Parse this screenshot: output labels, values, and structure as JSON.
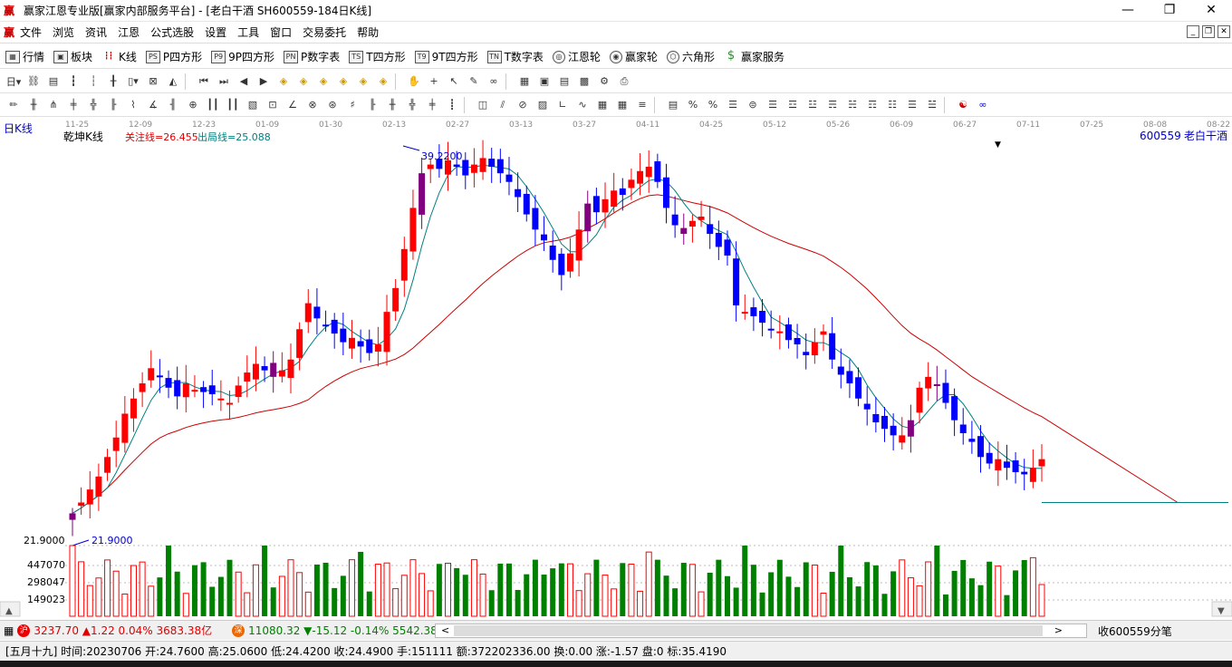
{
  "window": {
    "title": "赢家江恩专业版[赢家内部服务平台] - [老白干酒  SH600559-184日K线]",
    "logo_text": "赢"
  },
  "menu": [
    "文件",
    "浏览",
    "资讯",
    "江恩",
    "公式选股",
    "设置",
    "工具",
    "窗口",
    "交易委托",
    "帮助"
  ],
  "toolbar1": [
    {
      "label": "行情",
      "icon": "grid-icon"
    },
    {
      "label": "板块",
      "icon": "blocks-icon"
    },
    {
      "label": "K线",
      "icon": "kline-icon"
    },
    {
      "label": "P四方形",
      "icon": "ps-icon",
      "glyph": "PS"
    },
    {
      "label": "9P四方形",
      "icon": "p9-icon",
      "glyph": "P9"
    },
    {
      "label": "P数字表",
      "icon": "pn-icon",
      "glyph": "PN"
    },
    {
      "label": "T四方形",
      "icon": "ts-icon",
      "glyph": "TS"
    },
    {
      "label": "9T四方形",
      "icon": "t9-icon",
      "glyph": "T9"
    },
    {
      "label": "T数字表",
      "icon": "tn-icon",
      "glyph": "TN"
    },
    {
      "label": "江恩轮",
      "icon": "wheel-icon"
    },
    {
      "label": "赢家轮",
      "icon": "winner-wheel-icon"
    },
    {
      "label": "六角形",
      "icon": "hexagon-icon"
    },
    {
      "label": "赢家服务",
      "icon": "dollar-icon",
      "glyph": "$"
    }
  ],
  "chart": {
    "period_label": "日K线",
    "indicator_name": "乾坤K线",
    "focus_label": "关注线=26.455",
    "exit_label": "出局线=25.088",
    "stock_code": "600559",
    "stock_name": "老白干酒",
    "high_marker": "39.2200",
    "low_marker": "21.9000",
    "low_axis_label": "21.9000",
    "date_ticks": [
      "11-25",
      "12-09",
      "12-23",
      "01-09",
      "01-30",
      "02-13",
      "02-27",
      "03-13",
      "03-27",
      "04-11",
      "04-25",
      "05-12",
      "05-26",
      "06-09",
      "06-27",
      "07-11",
      "07-25",
      "08-08",
      "08-22"
    ],
    "volume_ticks": [
      "447070",
      "298047",
      "149023"
    ],
    "colors": {
      "up": "#ff0000",
      "down": "#0000ff",
      "transition": "#800080",
      "ma_short": "#008080",
      "ma_long": "#cc0000",
      "vol_up": "#ff0000",
      "vol_down": "#008000"
    }
  },
  "chart_data": {
    "type": "candlestick",
    "price_range": [
      21.9,
      39.22
    ],
    "closes": [
      22.3,
      22.8,
      23.4,
      24.0,
      24.9,
      25.8,
      26.9,
      27.6,
      28.3,
      29.0,
      28.6,
      28.1,
      27.7,
      28.3,
      28.0,
      27.9,
      27.8,
      27.6,
      27.4,
      28.2,
      28.8,
      29.2,
      28.9,
      28.6,
      28.9,
      29.4,
      30.8,
      32.0,
      31.3,
      31.0,
      30.6,
      30.2,
      30.4,
      30.0,
      29.7,
      30.1,
      31.6,
      32.7,
      34.5,
      36.4,
      38.0,
      38.4,
      38.2,
      38.6,
      38.3,
      37.9,
      38.4,
      38.7,
      38.3,
      38.0,
      37.6,
      36.9,
      36.1,
      35.4,
      34.9,
      34.0,
      33.3,
      34.3,
      35.4,
      36.6,
      36.2,
      36.8,
      37.2,
      37.0,
      37.7,
      38.1,
      38.3,
      37.6,
      36.4,
      35.6,
      35.2,
      35.8,
      36.0,
      35.2,
      34.6,
      34.2,
      31.9,
      31.6,
      31.4,
      31.1,
      30.8,
      30.7,
      30.3,
      30.1,
      29.6,
      30.2,
      30.7,
      29.4,
      28.7,
      28.3,
      27.6,
      27.1,
      26.5,
      26.2,
      25.9,
      25.9,
      26.6,
      28.1,
      28.6,
      28.2,
      27.4,
      26.6,
      26.0,
      25.6,
      24.9,
      24.6,
      24.8,
      24.4,
      24.2,
      24.1,
      24.4,
      24.8
    ],
    "ma_short_end": 22.8,
    "ma_long_end": 22.8,
    "volume_axis": [
      149023,
      298047,
      447070
    ]
  }
}
